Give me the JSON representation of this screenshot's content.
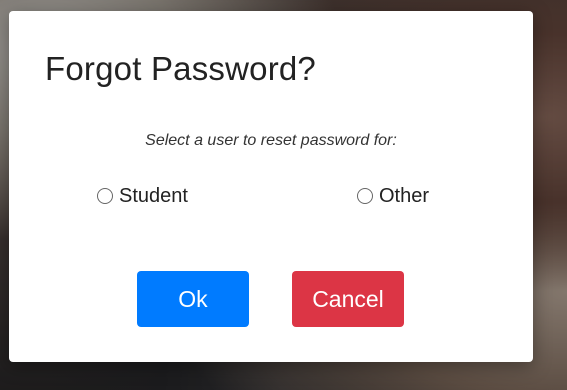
{
  "dialog": {
    "title": "Forgot Password?",
    "prompt": "Select a user to reset password for:",
    "options": [
      {
        "label": "Student",
        "selected": false
      },
      {
        "label": "Other",
        "selected": false
      }
    ],
    "ok_label": "Ok",
    "cancel_label": "Cancel"
  },
  "colors": {
    "ok_button": "#007bff",
    "cancel_button": "#dc3545"
  }
}
